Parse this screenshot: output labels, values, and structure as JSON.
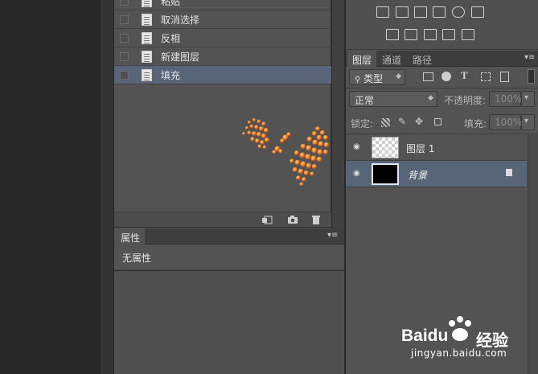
{
  "history": {
    "items": [
      {
        "label": "粘贴",
        "selected": false
      },
      {
        "label": "取消选择",
        "selected": false
      },
      {
        "label": "反相",
        "selected": false
      },
      {
        "label": "新建图层",
        "selected": false
      },
      {
        "label": "填充",
        "selected": true
      }
    ],
    "footer_icons": [
      "new-document-from-state-icon",
      "camera-icon",
      "trash-icon"
    ]
  },
  "properties": {
    "tab_label": "属性",
    "empty_text": "无属性"
  },
  "adjustments": {
    "icons": [
      "brightness-contrast-icon",
      "levels-icon",
      "curves-icon",
      "exposure-icon",
      "vibrance-icon",
      "hue-saturation-icon",
      "color-balance-icon",
      "black-white-icon",
      "photo-filter-icon",
      "channel-mixer-icon",
      "color-lookup-icon"
    ]
  },
  "layers_panel": {
    "tabs": [
      {
        "label": "图层",
        "active": true
      },
      {
        "label": "通道",
        "active": false
      },
      {
        "label": "路径",
        "active": false
      }
    ],
    "filter_kind": "类型",
    "blend_mode": "正常",
    "opacity_label": "不透明度:",
    "opacity_value": "100%",
    "lock_label": "锁定:",
    "fill_label": "填充:",
    "fill_value": "100%",
    "layers": [
      {
        "name": "图层 1",
        "visible": true,
        "selected": false,
        "thumb": "transparent"
      },
      {
        "name": "背景",
        "visible": true,
        "selected": true,
        "thumb": "black",
        "locked": true
      }
    ]
  },
  "watermark": {
    "brand": "Baidu",
    "brand_cn": "经验",
    "domain": "jingyan.baidu.com"
  },
  "colors": {
    "selected_row": "#586477",
    "panel_bg": "#535353",
    "canvas_orange": "#e07a2a"
  }
}
